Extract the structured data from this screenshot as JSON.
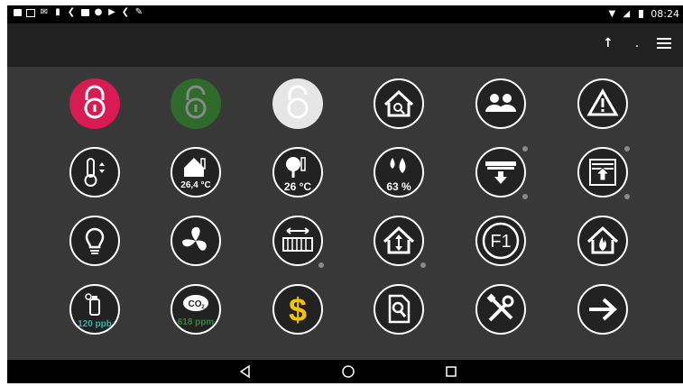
{
  "status_bar": {
    "time": "08:24",
    "left_icons": [
      "message-icon",
      "screen-icon",
      "mail-icon",
      "bookmark-icon",
      "back-arrow-icon",
      "cd-icon",
      "android-icon",
      "play-icon",
      "back-arrow-icon",
      "wrench-icon"
    ],
    "right_icons": [
      "wifi-icon",
      "signal-icon",
      "battery-icon"
    ]
  },
  "toolbar": {
    "up_label": "↑",
    "dot_label": ".",
    "menu_icon": "hamburger-menu-icon"
  },
  "tiles": {
    "temp_inside": "26,4 °C",
    "temp_outside": "26 °C",
    "humidity": "63 %",
    "voc": "120 ppb",
    "co2": "618 ppm"
  },
  "colors": {
    "background": "#383838",
    "toolbar": "#212121",
    "lock_red": "#d81b52",
    "lock_green": "#2e6b2a",
    "lock_white": "#e6e6e6",
    "dollar": "#f5c400",
    "voc_text": "#35b0a8",
    "co2_text": "#2b8a2e"
  }
}
